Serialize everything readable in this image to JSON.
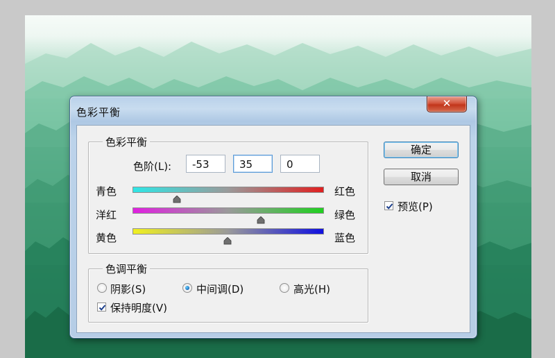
{
  "dialog": {
    "title": "色彩平衡",
    "close_symbol": "✕"
  },
  "color_balance": {
    "group_label": "色彩平衡",
    "levels_label": "色阶(L):",
    "levels": [
      "-53",
      "35",
      "0"
    ],
    "sliders": [
      {
        "left": "青色",
        "right": "红色",
        "value": -53,
        "left_color": "#2fe6e6",
        "right_color": "#e02020"
      },
      {
        "left": "洋红",
        "right": "绿色",
        "value": 35,
        "left_color": "#e020e0",
        "right_color": "#20d020"
      },
      {
        "left": "黄色",
        "right": "蓝色",
        "value": 0,
        "left_color": "#f0f020",
        "right_color": "#1010e0"
      }
    ],
    "range": [
      -100,
      100
    ]
  },
  "tone_balance": {
    "group_label": "色调平衡",
    "shadows_label": "阴影(S)",
    "midtones_label": "中间调(D)",
    "highlights_label": "高光(H)",
    "selected": "midtones",
    "preserve_luminosity_label": "保持明度(V)",
    "preserve_luminosity": true
  },
  "buttons": {
    "ok_label": "确定",
    "cancel_label": "取消"
  },
  "preview": {
    "label": "预览(P)",
    "checked": true
  },
  "icons": {
    "close": "close-icon",
    "slider_thumb": "slider-thumb-icon",
    "check": "checkmark-icon"
  }
}
